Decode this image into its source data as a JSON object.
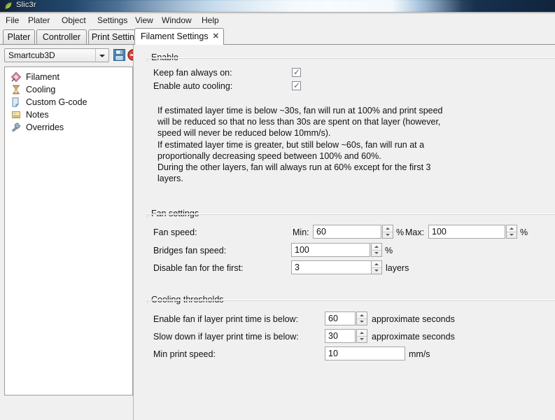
{
  "window": {
    "title": "Slic3r",
    "app_icon": "slic3r-leaf-icon"
  },
  "menu": {
    "items": [
      {
        "label": "File"
      },
      {
        "label": "Plater"
      },
      {
        "label": "Object"
      },
      {
        "label": "Settings"
      },
      {
        "label": "View"
      },
      {
        "label": "Window"
      },
      {
        "label": "Help"
      }
    ]
  },
  "tabs": {
    "items": [
      {
        "label": "Plater",
        "active": false
      },
      {
        "label": "Controller",
        "active": false
      },
      {
        "label": "Print Settings",
        "active": false
      },
      {
        "label": "Filament Settings",
        "active": true
      }
    ],
    "close_glyph": "✕"
  },
  "preset": {
    "value": "Smartcub3D",
    "save_icon": "save-floppy-icon",
    "delete_icon": "delete-circle-icon"
  },
  "sidebar": {
    "items": [
      {
        "label": "Filament",
        "icon": "filament-spool-icon"
      },
      {
        "label": "Cooling",
        "icon": "hourglass-icon"
      },
      {
        "label": "Custom G-code",
        "icon": "document-page-icon"
      },
      {
        "label": "Notes",
        "icon": "notes-icon"
      },
      {
        "label": "Overrides",
        "icon": "wrench-icon"
      }
    ]
  },
  "enable_group": {
    "title": "Enable",
    "keep_fan_label": "Keep fan always on:",
    "keep_fan_checked": true,
    "auto_cooling_label": "Enable auto cooling:",
    "auto_cooling_checked": true,
    "description_lines": [
      "If estimated layer time is below ~30s, fan will run at 100% and print speed",
      "will be reduced so that no less than 30s are spent on that layer (however,",
      "speed will never be reduced below 10mm/s).",
      "If estimated layer time is greater, but still below ~60s, fan will run at a",
      "proportionally decreasing speed between 100% and 60%.",
      "During the other layers, fan will always run at 60% except for the first 3",
      "layers."
    ]
  },
  "fan_settings": {
    "title": "Fan settings",
    "fan_speed_label": "Fan speed:",
    "min_prefix": "Min:",
    "min_value": "60",
    "min_unit": "%",
    "max_prefix": "Max:",
    "max_value": "100",
    "max_unit": "%",
    "bridges_label": "Bridges fan speed:",
    "bridges_value": "100",
    "bridges_unit": "%",
    "disable_first_label": "Disable fan for the first:",
    "disable_first_value": "3",
    "disable_first_unit": "layers"
  },
  "cooling_thresholds": {
    "title": "Cooling thresholds",
    "enable_fan_label": "Enable fan if layer print time is below:",
    "enable_fan_value": "60",
    "enable_fan_unit": "approximate seconds",
    "slow_down_label": "Slow down if layer print time is below:",
    "slow_down_value": "30",
    "slow_down_unit": "approximate seconds",
    "min_speed_label": "Min print speed:",
    "min_speed_value": "10",
    "min_speed_unit": "mm/s"
  },
  "colors": {
    "window_bg": "#f0f0f0",
    "panel_white": "#ffffff",
    "border": "#a6a6a6",
    "text": "#111111",
    "checkbox_tick": "#4a6a95",
    "save_icon_blue": "#4f8fc0",
    "delete_icon_red": "#d0342c"
  }
}
